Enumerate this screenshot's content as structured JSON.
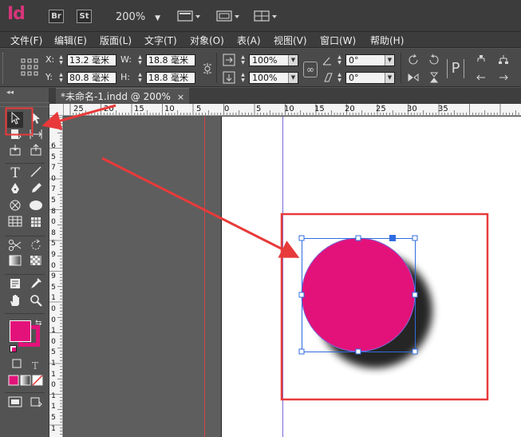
{
  "app": {
    "logo": "Id",
    "badges": [
      "Br",
      "St"
    ],
    "zoom": "200%"
  },
  "menu": [
    "文件(F)",
    "编辑(E)",
    "版面(L)",
    "文字(T)",
    "对象(O)",
    "表(A)",
    "视图(V)",
    "窗口(W)",
    "帮助(H)"
  ],
  "control": {
    "x_label": "X:",
    "x_value": "13.2 毫米",
    "y_label": "Y:",
    "y_value": "80.8 毫米",
    "w_label": "W:",
    "w_value": "18.8 毫米",
    "h_label": "H:",
    "h_value": "18.8 毫米",
    "scale_x": "100%",
    "scale_y": "100%",
    "rotate": "0°",
    "shear": "0°"
  },
  "document": {
    "tab_title": "*未命名-1.indd @ 200%",
    "tab_close": "×"
  },
  "ruler": {
    "h_labels": [
      "25",
      "20",
      "15",
      "10",
      "5",
      "0",
      "5",
      "10",
      "15",
      "20",
      "25",
      "30",
      "35"
    ],
    "v_labels": [
      "6",
      "5",
      "7",
      "0",
      "7",
      "5",
      "8",
      "0",
      "8",
      "5",
      "9",
      "0",
      "9",
      "5",
      "1",
      "0",
      "0",
      "1",
      "0",
      "5",
      "1",
      "1",
      "0",
      "1",
      "1",
      "5",
      "1"
    ]
  },
  "tools": {
    "type_label": "T"
  },
  "colors": {
    "fill": "#e3127a",
    "annotation": "#e83a3a",
    "selection": "#2f6ce0",
    "margin": "#d34545",
    "column_guide": "#7a6ad8"
  },
  "annotation": {
    "highlight_tool": "selection-tool",
    "highlight_target": "circle-frame"
  }
}
